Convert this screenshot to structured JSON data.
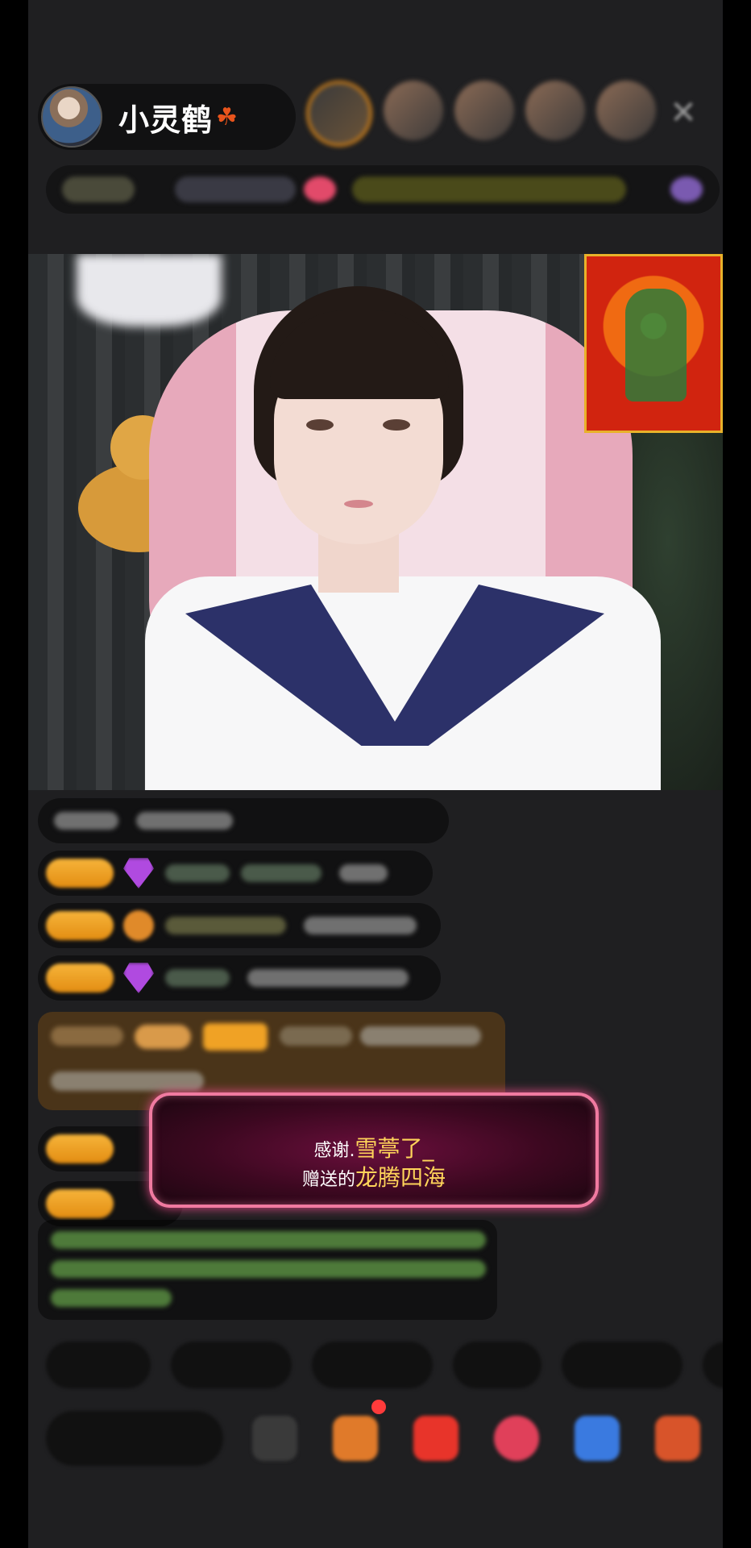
{
  "header": {
    "host_name": "小灵鹤",
    "host_icon": "maple-leaf-icon",
    "viewer_count_hint": "",
    "close_icon": "close-icon"
  },
  "video": {
    "poster_icon": "god-of-wealth-poster"
  },
  "gift_toast": {
    "thanks": "感谢.",
    "sender": "雪葶了_",
    "gave": "赠送的",
    "gift": "龙腾四海"
  },
  "colors": {
    "toast_border": "#f07aa0",
    "gift_highlight": "#ffd45a",
    "badge": "#f2a52a"
  }
}
